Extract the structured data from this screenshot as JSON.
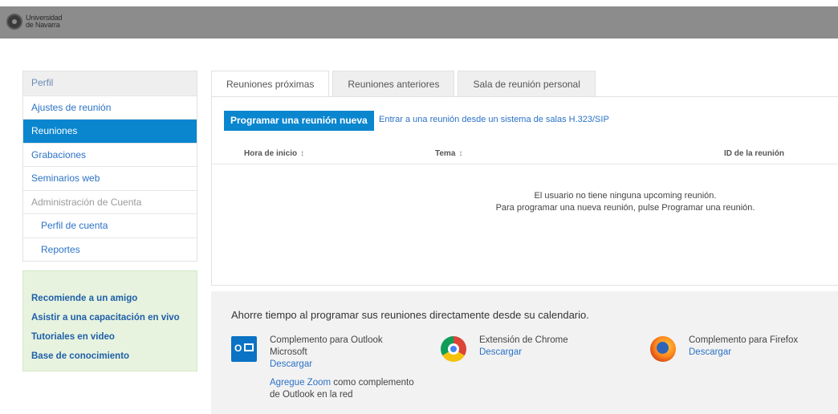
{
  "header": {
    "logo_line1": "Universidad",
    "logo_line2": "de Navarra",
    "bar_color": "#8c8c8c"
  },
  "sidebar": {
    "items": [
      {
        "label": "Perfil"
      },
      {
        "label": "Ajustes de reunión"
      },
      {
        "label": "Reuniones",
        "active": true
      },
      {
        "label": "Grabaciones"
      },
      {
        "label": "Seminarios web"
      },
      {
        "label": "Administración de Cuenta"
      },
      {
        "label": "Perfil de cuenta"
      },
      {
        "label": "Reportes"
      }
    ]
  },
  "promo": {
    "links": [
      "Recomiende a un amigo",
      "Asistir a una capacitación en vivo",
      "Tutoriales en video",
      "Base de conocimiento"
    ]
  },
  "tabs": [
    {
      "label": "Reuniones próximas",
      "active": true
    },
    {
      "label": "Reuniones anteriores"
    },
    {
      "label": "Sala de reunión personal"
    }
  ],
  "meetings": {
    "schedule_button": "Programar una reunión nueva",
    "sip_link": "Entrar a una reunión desde un sistema de salas H.323/SIP",
    "columns": [
      {
        "label": "Hora de inicio",
        "sort": "↕"
      },
      {
        "label": "Tema",
        "sort": "↕"
      },
      {
        "label": "ID de la reunión"
      }
    ],
    "empty_line1": "El usuario no tiene ninguna upcoming reunión.",
    "empty_line2": "Para programar una nueva reunión, pulse Programar una reunión."
  },
  "calendar": {
    "title": "Ahorre tiempo al programar sus reuniones directamente desde su calendario.",
    "addons": [
      {
        "icon": "outlook-icon",
        "name": "Complemento para Outlook Microsoft",
        "download": "Descargar"
      },
      {
        "icon": "chrome-icon",
        "name": "Extensión de Chrome",
        "download": "Descargar"
      },
      {
        "icon": "firefox-icon",
        "name": "Complemento para Firefox",
        "download": "Descargar"
      }
    ],
    "outlook_web_link": "Agregue Zoom",
    "outlook_web_text": " como complemento de Outlook en la red"
  },
  "colors": {
    "accent": "#0a86cf",
    "link": "#2b72c6",
    "promo_bg": "#e7f3df",
    "footer_bg": "#f2f2f2"
  }
}
